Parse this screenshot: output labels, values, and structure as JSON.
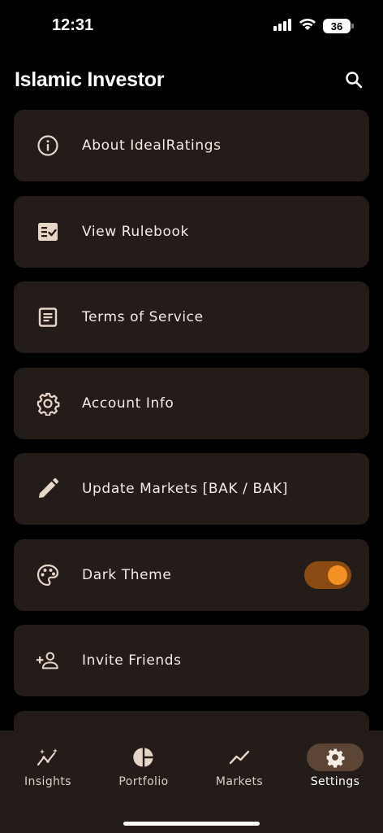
{
  "status": {
    "time": "12:31",
    "battery": "36"
  },
  "header": {
    "title": "Islamic Investor",
    "search_icon": "search-icon"
  },
  "menu": [
    {
      "label": "About IdealRatings",
      "icon": "info-icon"
    },
    {
      "label": "View Rulebook",
      "icon": "checklist-icon"
    },
    {
      "label": "Terms of Service",
      "icon": "document-icon"
    },
    {
      "label": "Account Info",
      "icon": "gear-icon"
    },
    {
      "label": "Update Markets [BAK / BAK]",
      "icon": "pencil-icon"
    },
    {
      "label": "Dark Theme",
      "icon": "palette-icon",
      "toggle": true
    },
    {
      "label": "Invite Friends",
      "icon": "add-person-icon"
    }
  ],
  "dark_theme_enabled": true,
  "nav": {
    "items": [
      {
        "label": "Insights",
        "icon": "sparkle-chart-icon"
      },
      {
        "label": "Portfolio",
        "icon": "pie-chart-icon"
      },
      {
        "label": "Markets",
        "icon": "trend-line-icon"
      },
      {
        "label": "Settings",
        "icon": "gear-icon",
        "active": true
      }
    ]
  },
  "colors": {
    "background": "#000000",
    "card": "#231c19",
    "icon": "#e6d6c8",
    "accent": "#f29024",
    "toggle_track": "#8a4a12",
    "nav_active_pill": "#5c4535"
  }
}
